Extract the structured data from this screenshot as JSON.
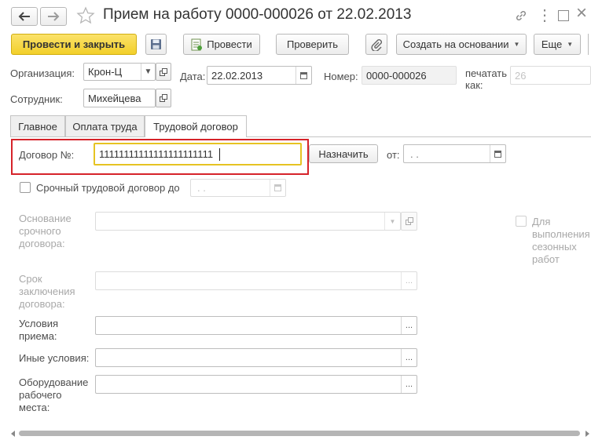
{
  "window": {
    "title": "Прием на работу 0000-000026 от 22.02.2013",
    "more_icon": "⋮",
    "close_icon": "×"
  },
  "toolbar": {
    "post_and_close": "Провести и закрыть",
    "post": "Провести",
    "check": "Проверить",
    "create_based_on": "Создать на основании",
    "more": "Еще"
  },
  "header": {
    "organization_label": "Организация:",
    "organization_value": "Крон-Ц",
    "date_label": "Дата:",
    "date_value": "22.02.2013",
    "number_label": "Номер:",
    "number_value": "0000-000026",
    "print_as_label_1": "печатать",
    "print_as_label_2": "как:",
    "print_as_value": "26",
    "employee_label": "Сотрудник:",
    "employee_value": "Михейцева"
  },
  "tabs": [
    {
      "label": "Главное"
    },
    {
      "label": "Оплата труда"
    },
    {
      "label": "Трудовой договор"
    }
  ],
  "contract": {
    "number_label": "Договор №:",
    "number_value": "11111111111111111111111",
    "assign_button": "Назначить",
    "from_label": "от:",
    "from_value": " .  .",
    "fixed_term_label": "Срочный трудовой договор до",
    "fixed_term_date": " .  .",
    "basis_label_1": "Основание",
    "basis_label_2": "срочного",
    "basis_label_3": "договора:",
    "seasonal_label_1": "Для",
    "seasonal_label_2": "выполнения",
    "seasonal_label_3": "сезонных",
    "seasonal_label_4": "работ",
    "term_label_1": "Срок",
    "term_label_2": "заключения",
    "term_label_3": "договора:",
    "conditions_label_1": "Условия",
    "conditions_label_2": "приема:",
    "other_label": "Иные условия:",
    "equipment_label_1": "Оборудование",
    "equipment_label_2": "рабочего",
    "equipment_label_3": "места:",
    "ellipsis": "..."
  },
  "colors": {
    "primary_button": "#f5d636",
    "highlight_border": "#d6232a",
    "focus_border": "#e6c322"
  }
}
